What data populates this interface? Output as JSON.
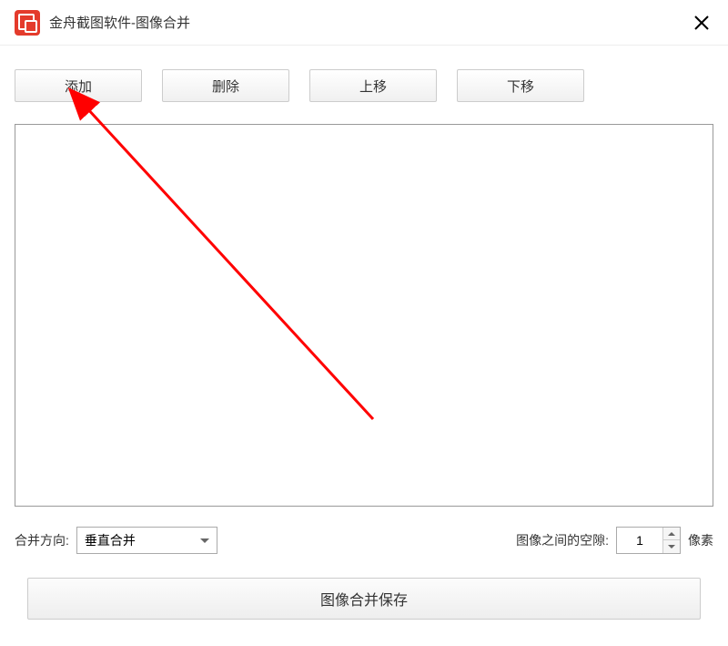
{
  "header": {
    "title": "金舟截图软件-图像合并"
  },
  "toolbar": {
    "add_label": "添加",
    "delete_label": "删除",
    "moveup_label": "上移",
    "movedown_label": "下移"
  },
  "controls": {
    "direction_label": "合并方向:",
    "direction_value": "垂直合并",
    "gap_label": "图像之间的空隙:",
    "gap_value": "1",
    "gap_unit": "像素"
  },
  "footer": {
    "save_label": "图像合并保存"
  }
}
